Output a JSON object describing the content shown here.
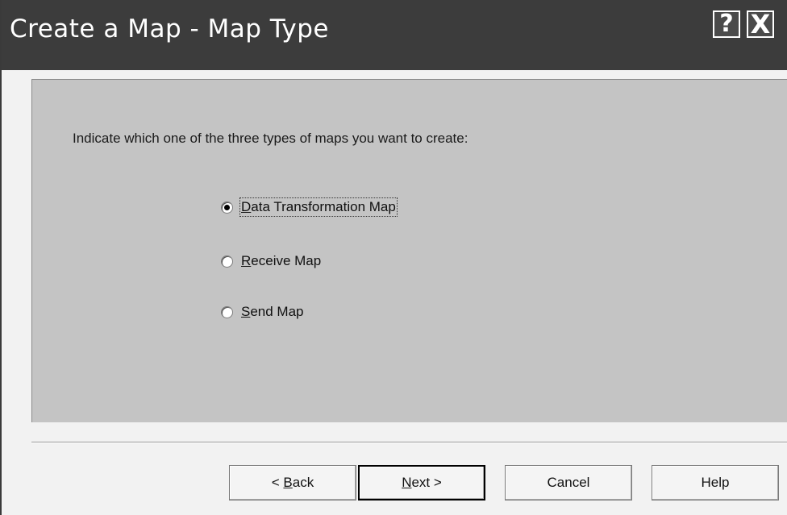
{
  "window": {
    "title": "Create a Map - Map Type",
    "help_glyph": "?",
    "close_glyph": "X"
  },
  "instruction": "Indicate which one of the three types of maps you want to create:",
  "options": [
    {
      "label": "Data Transformation Map",
      "mnemonic": "D",
      "rest": "ata Transformation Map",
      "selected": true
    },
    {
      "label": "Receive Map",
      "mnemonic": "R",
      "rest": "eceive Map",
      "selected": false
    },
    {
      "label": "Send Map",
      "mnemonic": "S",
      "rest": "end Map",
      "selected": false
    }
  ],
  "buttons": {
    "back_prefix": "< ",
    "back_mnemonic": "B",
    "back_rest": "ack",
    "next_mnemonic": "N",
    "next_rest": "ext >",
    "cancel": "Cancel",
    "help": "Help"
  },
  "colors": {
    "titlebar": "#3c3c3c",
    "panel": "#c4c4c4",
    "background": "#f2f2f2"
  }
}
